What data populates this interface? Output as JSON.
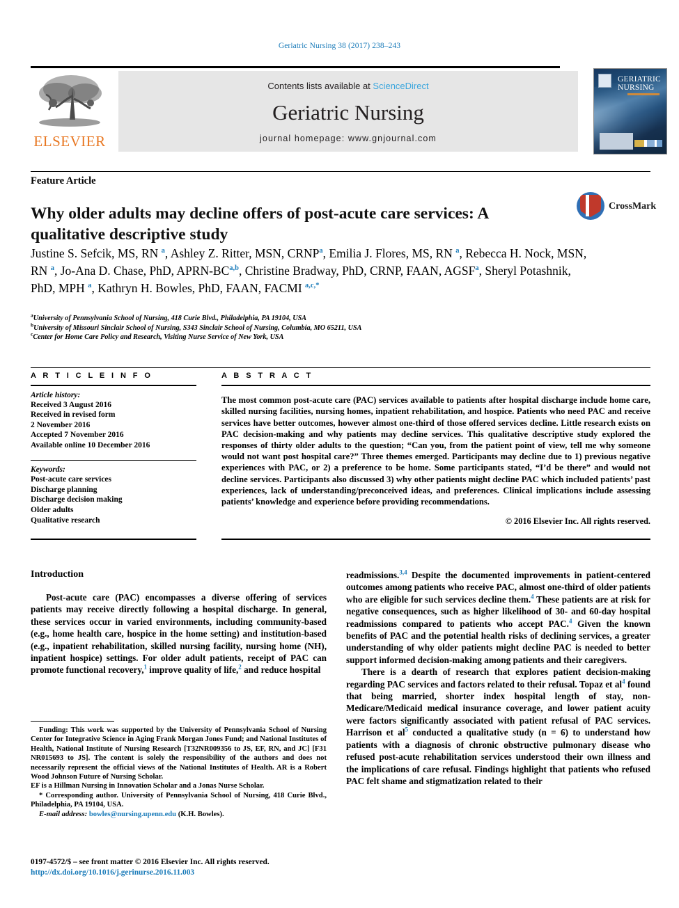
{
  "running_head": "Geriatric Nursing 38 (2017) 238–243",
  "masthead": {
    "contents_prefix": "Contents lists available at ",
    "sciencedirect": "ScienceDirect",
    "journal_title": "Geriatric Nursing",
    "homepage": "journal homepage: www.gnjournal.com",
    "publisher_logo_text": "ELSEVIER",
    "cover_title_line1": "GERIATRIC",
    "cover_title_line2": "NURSING"
  },
  "article": {
    "section_label": "Feature Article",
    "title": "Why older adults may decline offers of post-acute care services: A qualitative descriptive study",
    "crossmark_label": "CrossMark",
    "authors_html": "Justine S. Sefcik, MS, RN <sup>a</sup>, Ashley Z. Ritter, MSN, CRNP<sup>a</sup>, Emilia J. Flores, MS, RN <sup>a</sup>, Rebecca H. Nock, MSN, RN <sup>a</sup>, Jo-Ana D. Chase, PhD, APRN-BC<sup>a,b</sup>, Christine Bradway, PhD, CRNP, FAAN, AGSF<sup>a</sup>, Sheryl Potashnik, PhD, MPH <sup>a</sup>, Kathryn H. Bowles, PhD, FAAN, FACMI <sup>a,c,*</sup>",
    "affiliations": [
      {
        "marker": "a",
        "text": "University of Pennsylvania School of Nursing, 418 Curie Blvd., Philadelphia, PA 19104, USA"
      },
      {
        "marker": "b",
        "text": "University of Missouri Sinclair School of Nursing, S343 Sinclair School of Nursing, Columbia, MO 65211, USA"
      },
      {
        "marker": "c",
        "text": "Center for Home Care Policy and Research, Visiting Nurse Service of New York, USA"
      }
    ]
  },
  "article_info": {
    "heading": "A R T I C L E   I N F O",
    "history_label": "Article history:",
    "history": [
      "Received 3 August 2016",
      "Received in revised form",
      "2 November 2016",
      "Accepted 7 November 2016",
      "Available online 10 December 2016"
    ],
    "keywords_label": "Keywords:",
    "keywords": [
      "Post-acute care services",
      "Discharge planning",
      "Discharge decision making",
      "Older adults",
      "Qualitative research"
    ]
  },
  "abstract": {
    "heading": "A B S T R A C T",
    "text": "The most common post-acute care (PAC) services available to patients after hospital discharge include home care, skilled nursing facilities, nursing homes, inpatient rehabilitation, and hospice. Patients who need PAC and receive services have better outcomes, however almost one-third of those offered services decline. Little research exists on PAC decision-making and why patients may decline services. This qualitative descriptive study explored the responses of thirty older adults to the question; “Can you, from the patient point of view, tell me why someone would not want post hospital care?” Three themes emerged. Participants may decline due to 1) previous negative experiences with PAC, or 2) a preference to be home. Some participants stated, “I’d be there” and would not decline services. Participants also discussed 3) why other patients might decline PAC which included patients’ past experiences, lack of understanding/preconceived ideas, and preferences. Clinical implications include assessing patients’ knowledge and experience before providing recommendations.",
    "copyright": "© 2016 Elsevier Inc. All rights reserved."
  },
  "body": {
    "intro_heading": "Introduction",
    "left_para_html": "Post-acute care (PAC) encompasses a diverse offering of services patients may receive directly following a hospital discharge. In general, these services occur in varied environments, including community-based (e.g., home health care, hospice in the home setting) and institution-based (e.g., inpatient rehabilitation, skilled nursing facility, nursing home (NH), inpatient hospice) settings. For older adult patients, receipt of PAC can promote functional recovery,<sup>1</sup> improve quality of life,<sup>2</sup> and reduce hospital",
    "right_para1_html": "readmissions.<sup>3,4</sup> Despite the documented improvements in patient-centered outcomes among patients who receive PAC, almost one-third of older patients who are eligible for such services decline them.<sup>4</sup> These patients are at risk for negative consequences, such as higher likelihood of 30- and 60-day hospital readmissions compared to patients who accept PAC.<sup>4</sup> Given the known benefits of PAC and the potential health risks of declining services, a greater understanding of why older patients might decline PAC is needed to better support informed decision-making among patients and their caregivers.",
    "right_para2_html": "There is a dearth of research that explores patient decision-making regarding PAC services and factors related to their refusal. Topaz et al<sup>4</sup> found that being married, shorter index hospital length of stay, non-Medicare/Medicaid medical insurance coverage, and lower patient acuity were factors significantly associated with patient refusal of PAC services. Harrison et al<sup>5</sup> conducted a qualitative study (n = 6) to understand how patients with a diagnosis of chronic obstructive pulmonary disease who refused post-acute rehabilitation services understood their own illness and the implications of care refusal. Findings highlight that patients who refused PAC felt shame and stigmatization related to their"
  },
  "footnotes": {
    "funding_html": "Funding: This work was supported by the University of Pennsylvania School of Nursing Center for Integrative Science in Aging Frank Morgan Jones Fund; and National Institutes of Health, National Institute of Nursing Research [T32NR009356 to JS, EF, RN, and JC] [F31 NR015693 to JS]. The content is solely the responsibility of the authors and does not necessarily represent the official views of the National Institutes of Health. AR is a Robert Wood Johnson Future of Nursing Scholar.",
    "scholar_line": "EF is a Hillman Nursing in Innovation Scholar and a Jonas Nurse Scholar.",
    "corresponding_html": "* Corresponding author. University of Pennsylvania School of Nursing, 418 Curie Blvd., Philadelphia, PA 19104, USA.",
    "email_label": "E-mail address:",
    "email": "bowles@nursing.upenn.edu",
    "email_owner": "(K.H. Bowles)."
  },
  "footer": {
    "issn_line": "0197-4572/$ – see front matter © 2016 Elsevier Inc. All rights reserved.",
    "doi": "http://dx.doi.org/10.1016/j.gerinurse.2016.11.003"
  },
  "colors": {
    "link_blue": "#1a7bb9",
    "sciencedirect_blue": "#3ba6dd",
    "elsevier_orange": "#e87722",
    "masthead_gray": "#e6e6e6"
  }
}
